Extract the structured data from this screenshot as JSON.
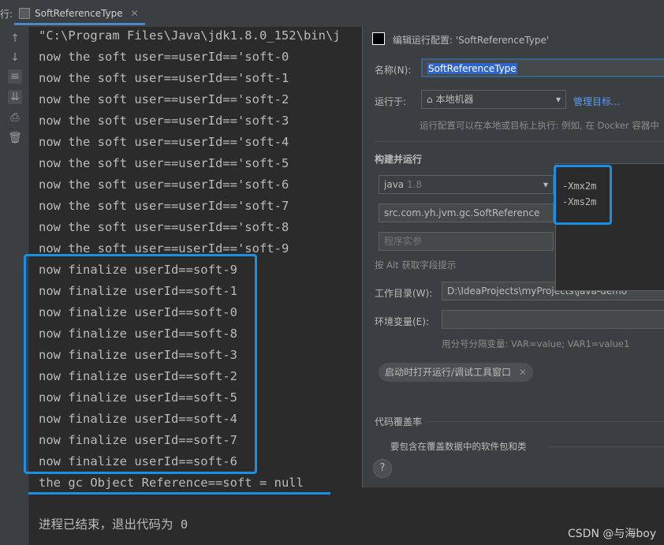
{
  "tabbar": {
    "run_label": "行:",
    "tab_title": "SoftReferenceType",
    "tab_close": "✕"
  },
  "console": {
    "lines": [
      "\"C:\\Program Files\\Java\\jdk1.8.0_152\\bin\\j",
      "now the soft user==userId=='soft-0",
      "now the soft user==userId=='soft-1",
      "now the soft user==userId=='soft-2",
      "now the soft user==userId=='soft-3",
      "now the soft user==userId=='soft-4",
      "now the soft user==userId=='soft-5",
      "now the soft user==userId=='soft-6",
      "now the soft user==userId=='soft-7",
      "now the soft user==userId=='soft-8",
      "now the soft user==userId=='soft-9",
      "now finalize userId==soft-9",
      "now finalize userId==soft-1",
      "now finalize userId==soft-0",
      "now finalize userId==soft-8",
      "now finalize userId==soft-3",
      "now finalize userId==soft-2",
      "now finalize userId==soft-5",
      "now finalize userId==soft-4",
      "now finalize userId==soft-7",
      "now finalize userId==soft-6",
      "the gc Object Reference==soft = null"
    ],
    "exit_line": "进程已结束，退出代码为 0"
  },
  "dialog": {
    "title": "编辑运行配置: 'SoftReferenceType'",
    "name_label": "名称(N):",
    "name_value": "SoftReferenceType",
    "run_on_label": "运行于:",
    "run_on_value": "本地机器",
    "manage_targets": "管理目标...",
    "run_on_hint": "运行配置可以在本地或目标上执行: 例如, 在 Docker 容器中",
    "build_run_label": "构建并运行",
    "jdk_value": "java",
    "jdk_version": "1.8",
    "main_class": "src.com.yh.jvm.gc.SoftReference",
    "program_args_placeholder": "程序实参",
    "alt_hint": "按 Alt 获取字段提示",
    "workdir_label": "工作目录(W):",
    "workdir_value": "D:\\IdeaProjects\\myProjects\\java-demo",
    "env_label": "环境变量(E):",
    "env_hint": "用分号分隔变量: VAR=value; VAR1=value1",
    "open_tool_window_chip": "启动时打开运行/调试工具窗口",
    "coverage_label": "代码覆盖率",
    "coverage_hint": "要包含在覆盖数据中的软件包和类",
    "help": "?",
    "vm_options": [
      "-Xmx2m",
      "-Xms2m"
    ]
  },
  "watermark": "CSDN @与海boy",
  "colors": {
    "highlight": "#1a8fe3",
    "console_bg": "#2b2b2b",
    "panel_bg": "#3c3f41"
  }
}
